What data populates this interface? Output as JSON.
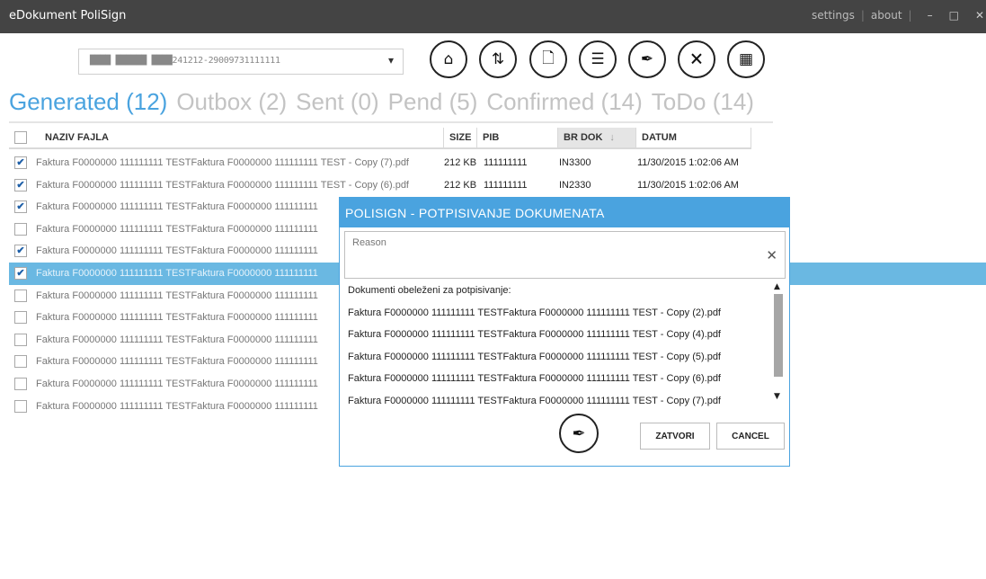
{
  "window": {
    "title": "eDokument PoliSign",
    "links": [
      "settings",
      "about"
    ],
    "controls": [
      "–",
      "□",
      "✕"
    ]
  },
  "document_selector": {
    "value": "████ ██████ ████241212-29009731111111"
  },
  "toolbar": {
    "buttons": [
      {
        "name": "home-icon",
        "glyph": "⌂"
      },
      {
        "name": "sync-icon",
        "glyph": "⇅"
      },
      {
        "name": "document-icon",
        "glyph": "🗋"
      },
      {
        "name": "list-icon",
        "glyph": "☰"
      },
      {
        "name": "sign-icon",
        "glyph": "✒"
      },
      {
        "name": "document-x-icon",
        "glyph": "🗙"
      },
      {
        "name": "excel-icon",
        "glyph": "▦"
      }
    ]
  },
  "tabs": [
    {
      "label": "Generated (12)",
      "active": true
    },
    {
      "label": "Outbox (2)",
      "active": false
    },
    {
      "label": "Sent (0)",
      "active": false
    },
    {
      "label": "Pend (5)",
      "active": false
    },
    {
      "label": "Confirmed (14)",
      "active": false
    },
    {
      "label": "ToDo (14)",
      "active": false
    }
  ],
  "grid": {
    "columns": [
      "NAZIV FAJLA",
      "SIZE",
      "PIB",
      "BR DOK",
      "DATUM"
    ],
    "sort_arrow": "↓",
    "rows": [
      {
        "checked": true,
        "selected": false,
        "name": "Faktura F0000000 111111111 TESTFaktura F0000000 111111111 TEST - Copy (7).pdf",
        "size": "212 KB",
        "pib": "111111111",
        "brdok": "IN3300",
        "datum": "11/30/2015 1:02:06 AM"
      },
      {
        "checked": true,
        "selected": false,
        "name": "Faktura F0000000 111111111 TESTFaktura F0000000 111111111 TEST - Copy (6).pdf",
        "size": "212 KB",
        "pib": "111111111",
        "brdok": "IN2330",
        "datum": "11/30/2015 1:02:06 AM"
      },
      {
        "checked": true,
        "selected": false,
        "name": "Faktura F0000000 111111111 TESTFaktura F0000000 111111111",
        "size": "",
        "pib": "",
        "brdok": "",
        "datum": ""
      },
      {
        "checked": false,
        "selected": false,
        "name": "Faktura F0000000 111111111 TESTFaktura F0000000 111111111",
        "size": "",
        "pib": "",
        "brdok": "",
        "datum": ""
      },
      {
        "checked": true,
        "selected": false,
        "name": "Faktura F0000000 111111111 TESTFaktura F0000000 111111111",
        "size": "",
        "pib": "",
        "brdok": "",
        "datum": ""
      },
      {
        "checked": true,
        "selected": true,
        "name": "Faktura F0000000 111111111 TESTFaktura F0000000 111111111",
        "size": "",
        "pib": "",
        "brdok": "",
        "datum": ""
      },
      {
        "checked": false,
        "selected": false,
        "name": "Faktura F0000000 111111111 TESTFaktura F0000000 111111111",
        "size": "",
        "pib": "",
        "brdok": "",
        "datum": ""
      },
      {
        "checked": false,
        "selected": false,
        "name": "Faktura F0000000 111111111 TESTFaktura F0000000 111111111",
        "size": "",
        "pib": "",
        "brdok": "",
        "datum": ""
      },
      {
        "checked": false,
        "selected": false,
        "name": "Faktura F0000000 111111111 TESTFaktura F0000000 111111111",
        "size": "",
        "pib": "",
        "brdok": "",
        "datum": ""
      },
      {
        "checked": false,
        "selected": false,
        "name": "Faktura F0000000 111111111 TESTFaktura F0000000 111111111",
        "size": "",
        "pib": "",
        "brdok": "",
        "datum": ""
      },
      {
        "checked": false,
        "selected": false,
        "name": "Faktura F0000000 111111111 TESTFaktura F0000000 111111111",
        "size": "",
        "pib": "",
        "brdok": "",
        "datum": ""
      },
      {
        "checked": false,
        "selected": false,
        "name": "Faktura F0000000 111111111 TESTFaktura F0000000 111111111",
        "size": "",
        "pib": "",
        "brdok": "",
        "datum": ""
      }
    ]
  },
  "dialog": {
    "title": "POLISIGN - POTPISIVANJE DOKUMENATA",
    "reason_placeholder": "Reason",
    "clear_glyph": "✕",
    "list_label": "Dokumenti obeleženi za potpisivanje:",
    "documents": [
      "Faktura F0000000 111111111 TESTFaktura F0000000 111111111 TEST - Copy (2).pdf",
      "Faktura F0000000 111111111 TESTFaktura F0000000 111111111 TEST - Copy (4).pdf",
      "Faktura F0000000 111111111 TESTFaktura F0000000 111111111 TEST - Copy (5).pdf",
      "Faktura F0000000 111111111 TESTFaktura F0000000 111111111 TEST - Copy (6).pdf",
      "Faktura F0000000 111111111 TESTFaktura F0000000 111111111 TEST - Copy (7).pdf"
    ],
    "sign_glyph": "✒",
    "close_label": "ZATVORI",
    "cancel_label": "CANCEL"
  },
  "colors": {
    "accent": "#4aa3df",
    "selected_row": "#6ab8e2",
    "titlebar": "#444444"
  }
}
